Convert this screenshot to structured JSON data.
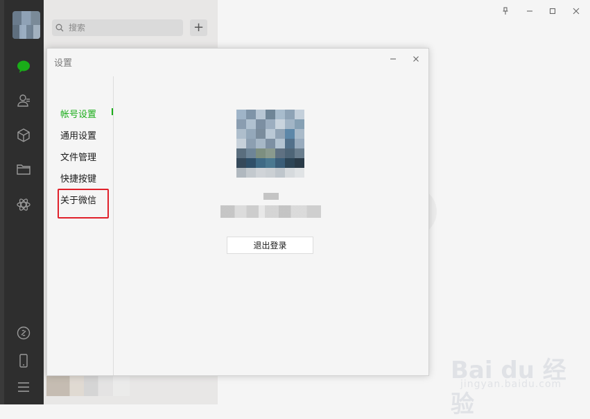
{
  "app": {
    "search": {
      "placeholder": "搜索"
    },
    "add_symbol": "+"
  },
  "rail": {
    "icons": [
      "chat-bubble-icon",
      "contacts-icon",
      "cube-icon",
      "folder-icon",
      "mini-program-icon",
      "link-icon",
      "phone-icon",
      "menu-icon"
    ],
    "accent": "#1aad19"
  },
  "settings": {
    "title": "设置",
    "nav": [
      {
        "label": "帐号设置",
        "active": true
      },
      {
        "label": "通用设置",
        "active": false
      },
      {
        "label": "文件管理",
        "active": false
      },
      {
        "label": "快捷按键",
        "active": false
      },
      {
        "label": "关于微信",
        "active": false,
        "highlighted": true
      }
    ],
    "logout_label": "退出登录",
    "highlight_color": "#e0202a"
  },
  "watermark": {
    "logo_text": "Bai du 经验",
    "sub_text": "jingyan.baidu.com"
  }
}
